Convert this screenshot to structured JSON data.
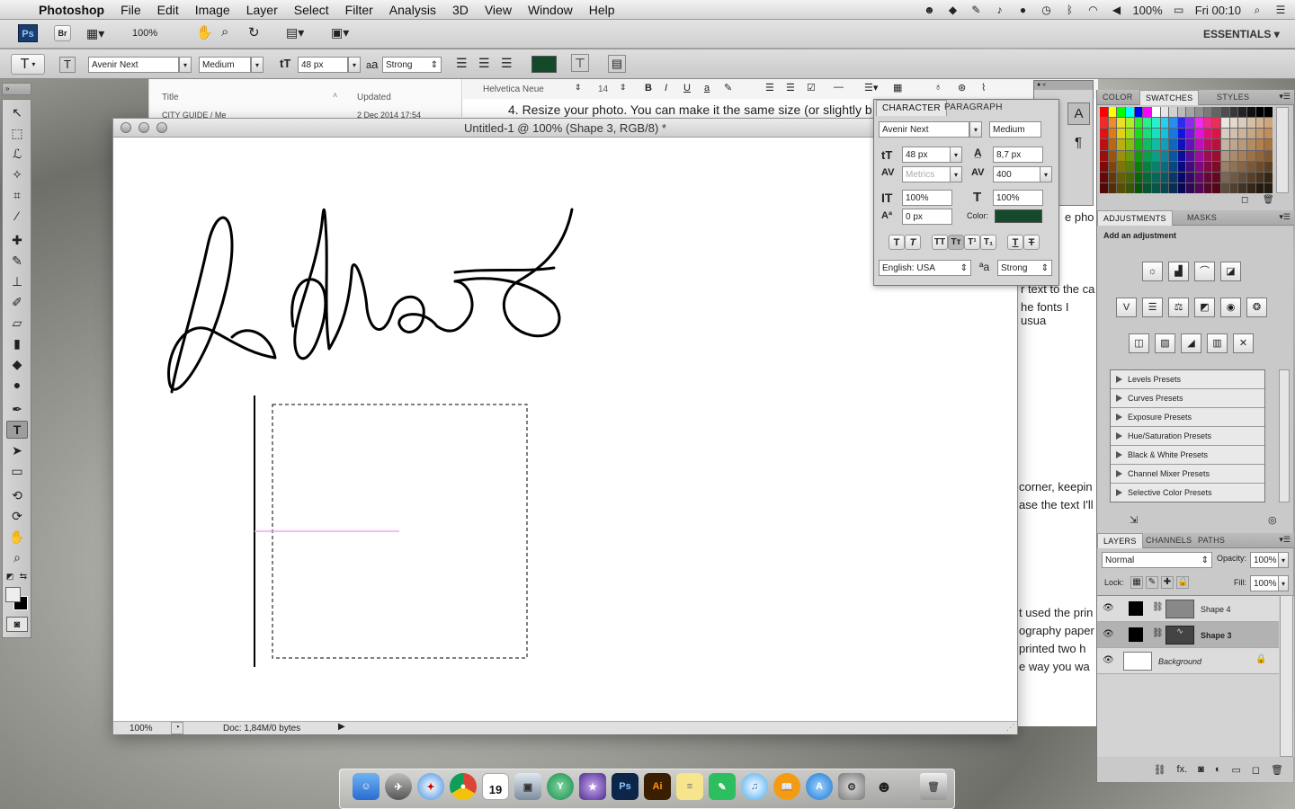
{
  "menubar": {
    "app": "Photoshop",
    "items": [
      "File",
      "Edit",
      "Image",
      "Layer",
      "Select",
      "Filter",
      "Analysis",
      "3D",
      "View",
      "Window",
      "Help"
    ],
    "battery": "100%",
    "clock": "Fri 00:10"
  },
  "appbar": {
    "ps_logo": "Ps",
    "br_logo": "Br",
    "zoom": "100%",
    "workspace": "ESSENTIALS"
  },
  "options": {
    "tool_glyph": "T",
    "font_family": "Avenir Next",
    "font_style": "Medium",
    "font_size": "48 px",
    "aa_label": "a",
    "aa_mode": "Strong",
    "color": "#144a2a"
  },
  "bgdoc": {
    "col_title": "Title",
    "col_updated": "Updated",
    "row_title": "CITY GUIDE / Me",
    "row_date": "2 Dec 2014 17:54",
    "font": "Helvetica Neue",
    "size": "14",
    "line1": "4. Resize your photo. You can make it the same size (or slightly b",
    "frag1": "e pho",
    "frag2": "r text to the ca",
    "frag3": "he fonts I usua",
    "frag4": "corner, keepin",
    "frag5": "ase the text I'll",
    "frag6": "t used the prin",
    "frag7": "ography paper",
    "frag8": "printed two h",
    "frag9": "e way you wa"
  },
  "document": {
    "title": "Untitled-1 @ 100% (Shape 3, RGB/8) *",
    "zoom": "100%",
    "doc_info": "Doc: 1,84M/0 bytes"
  },
  "character": {
    "tab1": "CHARACTER",
    "tab2": "PARAGRAPH",
    "font_family": "Avenir Next",
    "font_style": "Medium",
    "size": "48 px",
    "leading": "8,7 px",
    "kerning": "Metrics",
    "tracking": "400",
    "vscale": "100%",
    "hscale": "100%",
    "baseline": "0 px",
    "color_label": "Color:",
    "color": "#144a2a",
    "language": "English: USA",
    "aa_mode": "Strong"
  },
  "swatches": {
    "tabs": [
      "COLOR",
      "SWATCHES",
      "STYLES"
    ],
    "colors": [
      "#ff0000",
      "#ffff00",
      "#00ff00",
      "#00ffff",
      "#0000ff",
      "#ff00ff",
      "#ffffff",
      "#e6e6e6",
      "#d1d1d1",
      "#bbbbbb",
      "#a5a5a5",
      "#8f8f8f",
      "#7a7a7a",
      "#646464",
      "#4e4e4e",
      "#383838",
      "#232323",
      "#111111",
      "#000000",
      "#000000"
    ]
  },
  "adjustments": {
    "tabs": [
      "ADJUSTMENTS",
      "MASKS"
    ],
    "heading": "Add an adjustment",
    "presets": [
      "Levels Presets",
      "Curves Presets",
      "Exposure Presets",
      "Hue/Saturation Presets",
      "Black & White Presets",
      "Channel Mixer Presets",
      "Selective Color Presets"
    ]
  },
  "layers": {
    "tabs": [
      "LAYERS",
      "CHANNELS",
      "PATHS"
    ],
    "blend": "Normal",
    "opacity_label": "Opacity:",
    "opacity": "100%",
    "lock_label": "Lock:",
    "fill_label": "Fill:",
    "fill": "100%",
    "items": [
      {
        "name": "Shape 4"
      },
      {
        "name": "Shape 3"
      },
      {
        "name": "Background"
      }
    ]
  },
  "dock": {
    "calendar_day": "19",
    "ps": "Ps",
    "ai": "Ai"
  }
}
